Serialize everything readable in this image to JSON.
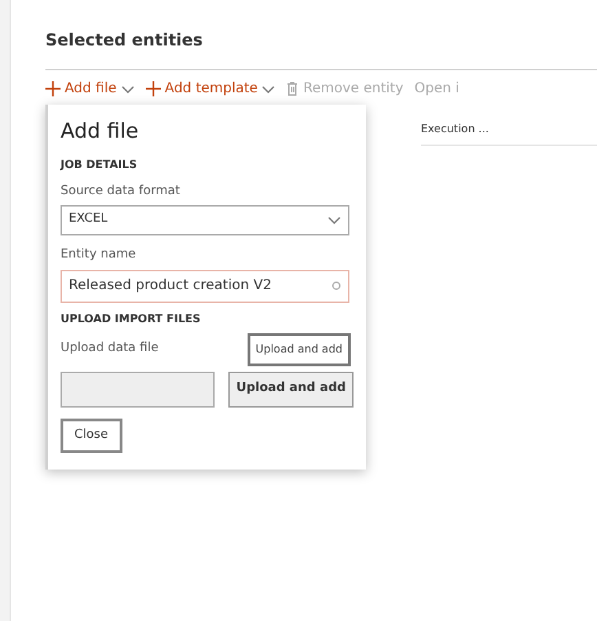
{
  "section_title": "Selected entities",
  "toolbar": [
    {
      "kind": "add",
      "label": "Add file",
      "disabled": false
    },
    {
      "kind": "add",
      "label": "Add template",
      "disabled": false
    },
    {
      "kind": "delete",
      "label": "Remove entity",
      "disabled": true
    },
    {
      "kind": "plain",
      "label": "Open i",
      "disabled": true
    }
  ],
  "grid": {
    "column_1": "Execution ..."
  },
  "dialog": {
    "title": "Add file",
    "job_details": {
      "heading": "JOB DETAILS",
      "source_label": "Source data format",
      "source_value": "EXCEL",
      "entity_label": "Entity name",
      "entity_value": "Released product creation V2"
    },
    "upload": {
      "heading": "UPLOAD IMPORT FILES",
      "file_label": "Upload data file",
      "tooltip": "Upload and add",
      "upload_button": "Upload and add"
    },
    "close_button": "Close"
  }
}
